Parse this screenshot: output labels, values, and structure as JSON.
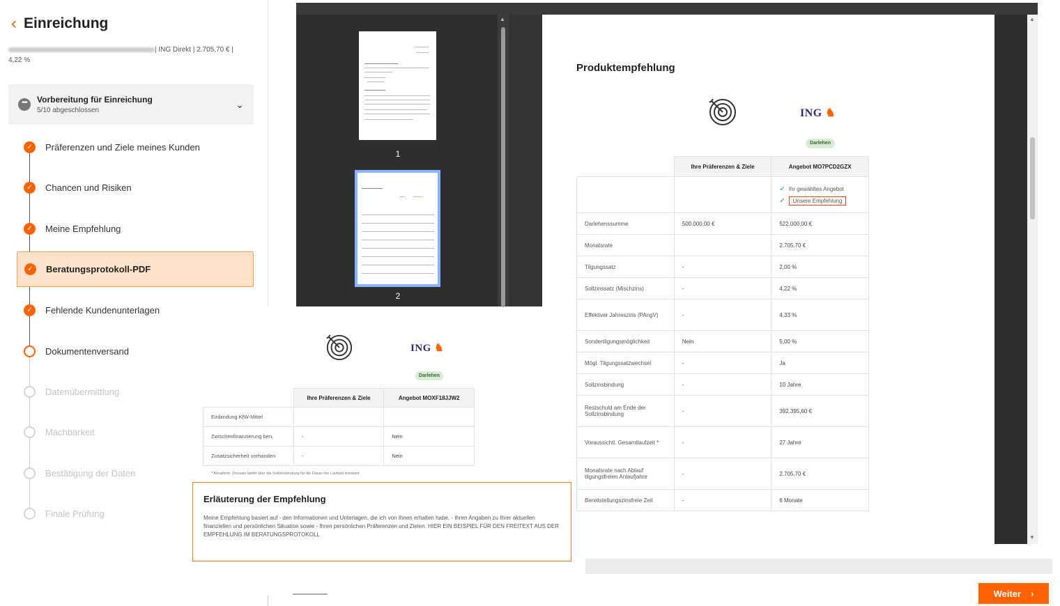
{
  "header": {
    "back_label": "Einreichung",
    "subtitle_visible": "| ING Direkt | 2.705,70 € |",
    "subtitle_rate": "4,22 %"
  },
  "preparation": {
    "title": "Vorbereitung für Einreichung",
    "progress": "5/10 abgeschlossen"
  },
  "steps": [
    {
      "label": "Präferenzen und Ziele meines Kunden",
      "state": "done"
    },
    {
      "label": "Chancen und Risiken",
      "state": "done"
    },
    {
      "label": "Meine Empfehlung",
      "state": "done"
    },
    {
      "label": "Beratungsprotokoll-PDF",
      "state": "active"
    },
    {
      "label": "Fehlende Kundenunterlagen",
      "state": "done"
    },
    {
      "label": "Dokumentenversand",
      "state": "open"
    },
    {
      "label": "Datenübermittlung",
      "state": "todo"
    },
    {
      "label": "Machbarkeit",
      "state": "todo"
    },
    {
      "label": "Bestätigung der Daten",
      "state": "todo"
    },
    {
      "label": "Finale Prüfung",
      "state": "todo"
    }
  ],
  "thumbnails": [
    {
      "page": "1"
    },
    {
      "page": "2"
    }
  ],
  "product": {
    "title": "Produktempfehlung",
    "bank": "ING",
    "pill": "Darlehen",
    "col_prefs": "Ihre Präferenzen & Ziele",
    "col_offer": "Angebot MO7PCD2GZX",
    "chosen_label": "Ihr gewähltes Angebot",
    "recommended_label": "Unsere Empfehlung",
    "rows": [
      {
        "key": "Darlehenssumme",
        "pref": "500.000,00 €",
        "offer": "522.000,00 €"
      },
      {
        "key": "Monatsrate",
        "pref": "",
        "offer": "2.705,70 €"
      },
      {
        "key": "Tilgungssatz",
        "pref": "-",
        "offer": "2,00 %"
      },
      {
        "key": "Sollzinssatz (Mischzins)",
        "pref": "-",
        "offer": "4,22 %"
      },
      {
        "key": "Effektiver Jahreszins (PAngV)",
        "pref": "-",
        "offer": "4,33 %"
      },
      {
        "key": "Sondertilgungsmöglichkeit",
        "pref": "Nein",
        "offer": "5,00 %"
      },
      {
        "key": "Mögl. Tilgungssatzwechsel",
        "pref": "-",
        "offer": "Ja"
      },
      {
        "key": "Sollzinsbindung",
        "pref": "-",
        "offer": "10 Jahre"
      },
      {
        "key": "Restschuld am Ende der Sollzinsbindung",
        "pref": "-",
        "offer": "392.395,60 €"
      },
      {
        "key": "Voraussichtl. Gesamtlaufzeit *",
        "pref": "-",
        "offer": "27 Jahre"
      },
      {
        "key": "Monatsrate nach Ablauf tilgungsfreien Anlaufjahre",
        "pref": "-",
        "offer": "2.705,70 €"
      },
      {
        "key": "Bereitstellungszinsfreie Zeit",
        "pref": "-",
        "offer": "6 Monate"
      }
    ]
  },
  "zoom": {
    "bank": "ING",
    "pill": "Darlehen",
    "col_prefs": "Ihre Präferenzen & Ziele",
    "col_offer": "Angebot MOXF18JJW2",
    "rows": [
      {
        "key": "Einbindung KfW-Mittel",
        "pref": "",
        "offer": ""
      },
      {
        "key": "Zwischenfinanzierung ben.",
        "pref": "-",
        "offer": "Nein"
      },
      {
        "key": "Zusatzsicherheit vorhanden",
        "pref": "-",
        "offer": "Nein"
      }
    ],
    "footnote": "* Annahme: Zinssatz bleibt über die Sollzinsbindung für die Dauer der Laufzeit konstant"
  },
  "explanation": {
    "title": "Erläuterung der Empfehlung",
    "text": "Meine Empfehlung basiert auf - den Informationen und Unterlagen, die ich von Ihnen erhalten habe, - Ihren Angaben zu Ihrer aktuellen finanziellen und persönlichen Situation sowie - Ihren persönlichen Präferenzen und Zielen. HIER EIN BEISPIEL FÜR DEN FREITEXT AUS DER EMPFEHLUNG IM BERATUNGSPROTOKOLL"
  },
  "footer": {
    "next_label": "Weiter"
  },
  "colors": {
    "accent": "#ff6200",
    "active_bg": "#fde3cc",
    "viewer_dark": "#2e2e2e"
  }
}
